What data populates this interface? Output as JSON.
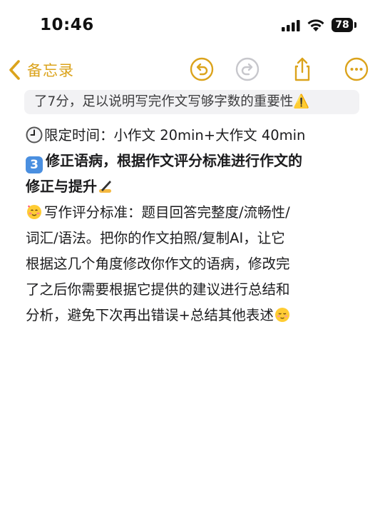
{
  "status_bar": {
    "time": "10:46",
    "battery": "78"
  },
  "nav": {
    "back_label": "备忘录",
    "accent_color": "#dba31c",
    "icons": [
      "undo-icon",
      "redo-icon",
      "share-icon",
      "more-icon"
    ]
  },
  "banner": {
    "text": "了7分，足以说明写完作文写够字数的重要性⚠️"
  },
  "note": {
    "line1": "限定时间：小作文 20min+大作文 40min",
    "line2": "修正语病，根据作文评分标准进行作文的",
    "line3": "修正与提升",
    "line4": "写作评分标准：题目回答完整度/流畅性/",
    "line5": "词汇/语法。把你的作文拍照/复制AI，让它",
    "line6": "根据这几个角度修改你作文的语病，修改完",
    "line7": "了之后你需要根据它提供的建议进行总结和",
    "line8": "分析，避免下次再出错误+总结其他表述"
  }
}
